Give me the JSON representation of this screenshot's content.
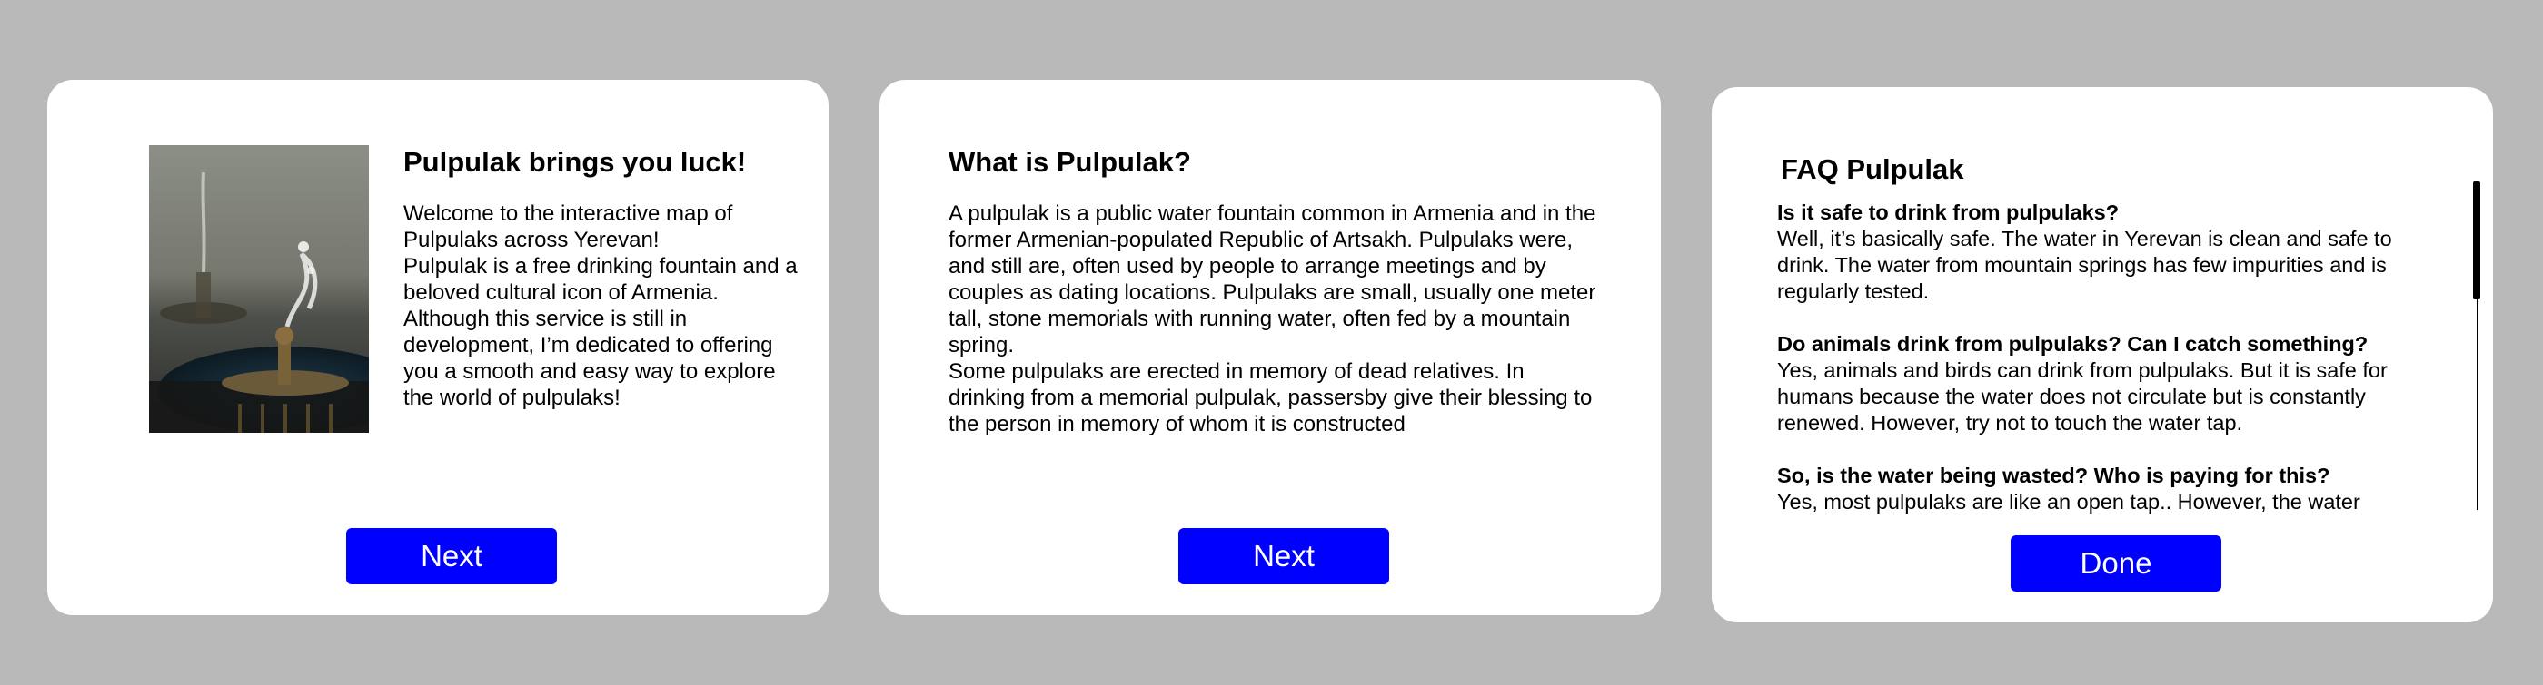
{
  "colors": {
    "background": "#b9b9b9",
    "card": "#ffffff",
    "button": "#0000ff",
    "button_text": "#ffffff"
  },
  "cards": [
    {
      "title": "Pulpulak brings you luck!",
      "image": "pulpulak-fountain-photo",
      "paragraphs": [
        "Welcome to the interactive map of Pulpulaks across Yerevan!",
        "Pulpulak is a free drinking fountain and a beloved cultural icon of Armenia. Although this service is still in development, I’m dedicated to offering you a smooth and easy way to explore the world of pulpulaks!"
      ],
      "button_label": "Next"
    },
    {
      "title": "What is Pulpulak?",
      "paragraphs": [
        "A pulpulak is a public water fountain common in Armenia and in the former Armenian-populated Republic of Artsakh. Pulpulaks were, and still are, often used by people to arrange meetings and by couples as dating locations. Pulpulaks are small, usually one meter tall, stone memorials with running water, often fed by a mountain spring.",
        "Some pulpulaks are erected in memory of dead relatives. In drinking from a memorial pulpulak, passersby give their blessing to the person in memory of whom it is constructed"
      ],
      "button_label": "Next"
    },
    {
      "title": "FAQ Pulpulak",
      "faq": [
        {
          "question": "Is it safe to drink from pulpulaks?",
          "answer": "Well, it’s basically safe. The water in Yerevan is clean and safe to drink. The water from mountain springs has few impurities and is regularly tested."
        },
        {
          "question": "Do animals drink from pulpulaks? Can I catch something?",
          "answer": " Yes, animals and birds can drink from pulpulaks. But it is safe for humans because the water does not circulate but is constantly renewed. However, try not to touch the water tap."
        },
        {
          "question": "So, is the water being wasted? Who is paying for this?",
          "answer": "Yes, most pulpulaks are like an open tap.. However, the water"
        }
      ],
      "button_label": "Done"
    }
  ]
}
